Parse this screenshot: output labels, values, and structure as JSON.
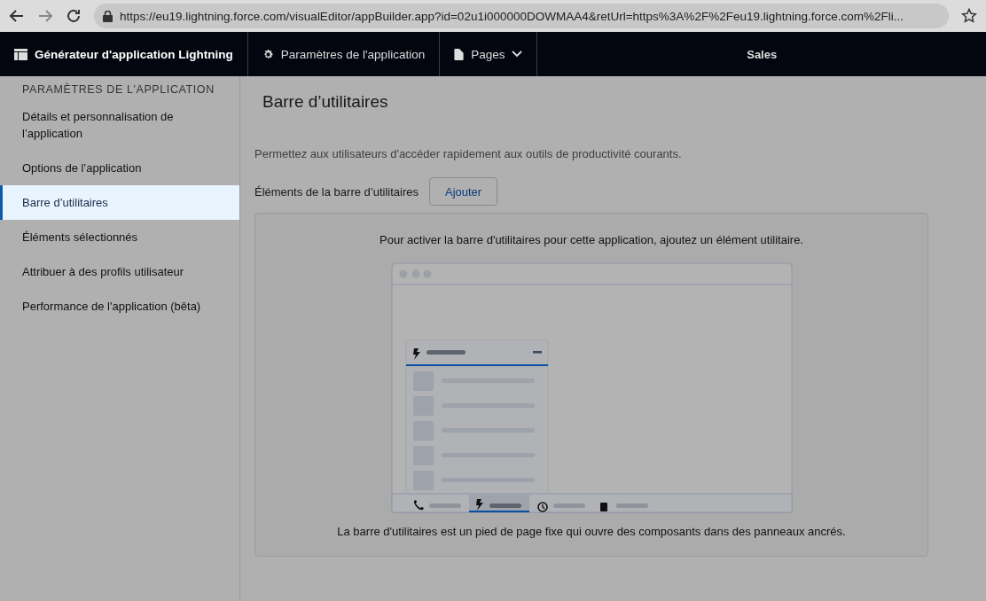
{
  "browser": {
    "url": "https://eu19.lightning.force.com/visualEditor/appBuilder.app?id=02u1i000000DOWMAA4&retUrl=https%3A%2F%2Feu19.lightning.force.com%2Fli..."
  },
  "nav": {
    "app_title": "Générateur d'application Lightning",
    "items": [
      {
        "label": "Paramètres de l'application",
        "kind": "settings"
      },
      {
        "label": "Pages",
        "kind": "pages"
      }
    ],
    "app_name": "Sales"
  },
  "sidebar": {
    "heading": "PARAMÈTRES DE L'APPLICATION",
    "items": [
      {
        "label": "Détails et personnalisation de l’application",
        "selected": false
      },
      {
        "label": "Options de l’application",
        "selected": false
      },
      {
        "label": "Barre d’utilitaires",
        "selected": true
      },
      {
        "label": "Éléments sélectionnés",
        "selected": false
      },
      {
        "label": "Attribuer à des profils utilisateur",
        "selected": false
      },
      {
        "label": "Performance de l'application (bêta)",
        "selected": false
      }
    ]
  },
  "main": {
    "title": "Barre d’utilitaires",
    "description": "Permettez aux utilisateurs d'accéder rapidement aux outils de productivité courants.",
    "section_label": "Éléments de la barre d’utilitaires",
    "add_button": "Ajouter",
    "empty_state": {
      "message": "Pour activer la barre d'utilitaires pour cette application, ajoutez un élément utilitaire.",
      "caption": "La barre d'utilitaires est un pied de page fixe qui ouvre des composants dans des panneaux ancrés."
    }
  }
}
